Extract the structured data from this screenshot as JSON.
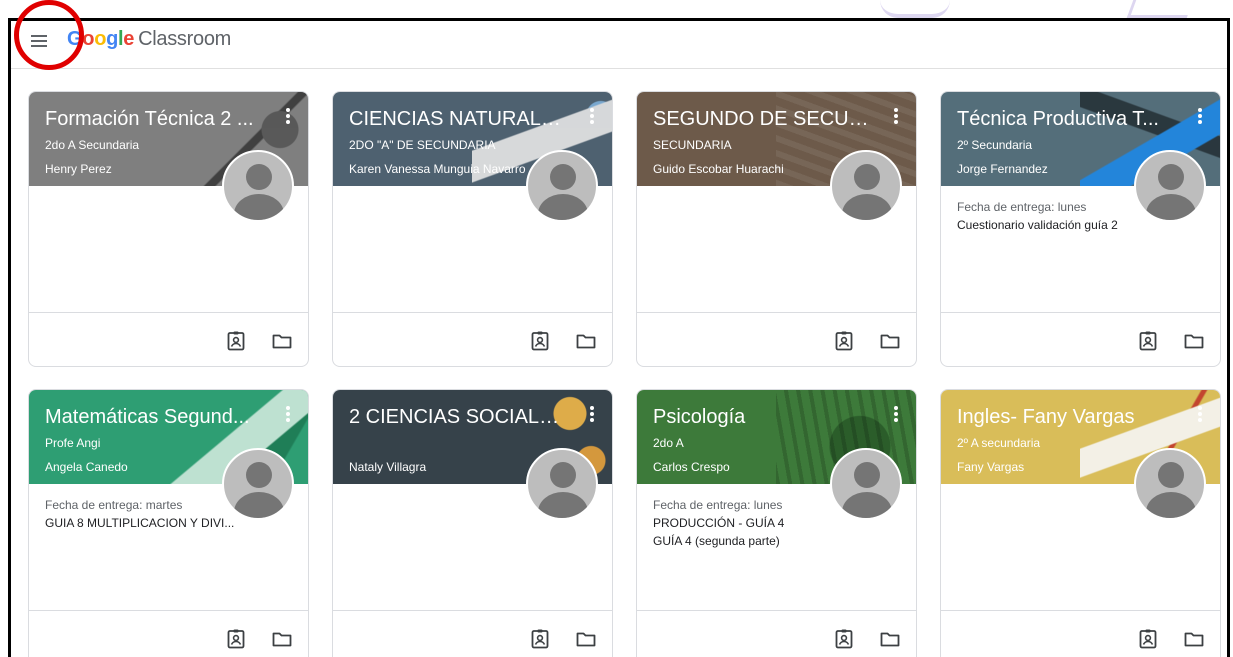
{
  "app": {
    "logo_google": "Google",
    "logo_product": "Classroom"
  },
  "colors": {
    "accent_red_annotation": "#e00000",
    "gray_card": "#7f7f7f",
    "slate_card": "#4e6170",
    "brown_card": "#6d4c41",
    "steel_card": "#546e7a",
    "green_card": "#2e9e73",
    "dark_card": "#36424a",
    "olive_card": "#3d7a3a",
    "yellow_card": "#d9bd59"
  },
  "cards": [
    {
      "title": "Formación Técnica 2 ...",
      "section": "2do A Secundaria",
      "teacher": "Henry Perez",
      "color": "#7f7f7f",
      "due": "",
      "work": []
    },
    {
      "title": "CIENCIAS NATURALE...",
      "section": "2DO \"A\" DE SECUNDARIA",
      "teacher": "Karen Vanessa Munguia Navarro",
      "color": "#4e6170",
      "due": "",
      "work": []
    },
    {
      "title": "SEGUNDO DE SECUN...",
      "section": "SECUNDARIA",
      "teacher": "Guido Escobar Huarachi",
      "color": "#6d5a4a",
      "due": "",
      "work": []
    },
    {
      "title": "Técnica Productiva T...",
      "section": "2º Secundaria",
      "teacher": "Jorge Fernandez",
      "color": "#546e7a",
      "due": "Fecha de entrega: lunes",
      "work": [
        "Cuestionario validación guía 2"
      ]
    },
    {
      "title": "Matemáticas Segund...",
      "section": "Profe Angi",
      "teacher": "Angela Canedo",
      "color": "#2e9e73",
      "due": "Fecha de entrega: martes",
      "work": [
        "GUIA 8 MULTIPLICACION Y DIVI..."
      ]
    },
    {
      "title": "2 CIENCIAS SOCIALE...",
      "section": "",
      "teacher": "Nataly Villagra",
      "color": "#36424a",
      "due": "",
      "work": []
    },
    {
      "title": "Psicología",
      "section": "2do A",
      "teacher": "Carlos Crespo",
      "color": "#3d7a3a",
      "due": "Fecha de entrega: lunes",
      "work": [
        "PRODUCCIÓN - GUÍA 4",
        "GUÍA 4 (segunda parte)"
      ]
    },
    {
      "title": "Ingles- Fany Vargas",
      "section": "2º A secundaria",
      "teacher": "Fany Vargas",
      "color": "#d9bd59",
      "due": "",
      "work": []
    }
  ],
  "icons": {
    "menu": "hamburger-menu-icon",
    "more": "more-vert-icon",
    "portfolio": "assignment-ind-icon",
    "folder": "folder-icon",
    "avatar": "default-avatar-icon"
  }
}
